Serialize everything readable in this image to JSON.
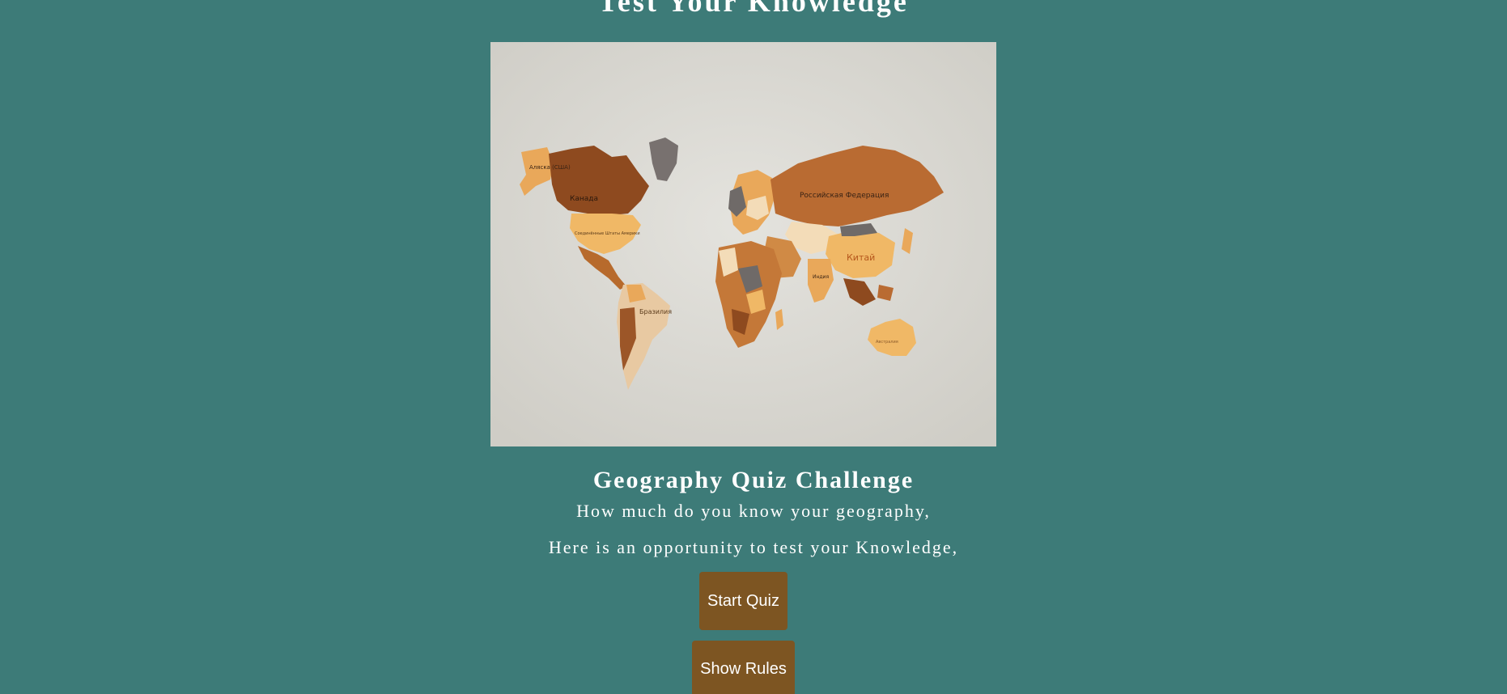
{
  "header": {
    "title": "Test Your Knowledge"
  },
  "hero": {
    "image_icon": "world-map-image",
    "map_labels": {
      "alaska": "Аляска (США)",
      "canada": "Канада",
      "usa": "Соединённые Штаты Америки",
      "brazil": "Бразилия",
      "russia": "Российская Федерация",
      "china": "Китай",
      "india": "Индия",
      "australia": "Австралия"
    }
  },
  "quiz": {
    "title": "Geography Quiz Challenge",
    "line1": "How much do you know your geography,",
    "line2": "Here is an opportunity to test your Knowledge,"
  },
  "buttons": {
    "start_label": "Start Quiz",
    "rules_label": "Show Rules"
  },
  "colors": {
    "background": "#3d7b78",
    "button": "#7d5522",
    "text": "#ffffff"
  }
}
